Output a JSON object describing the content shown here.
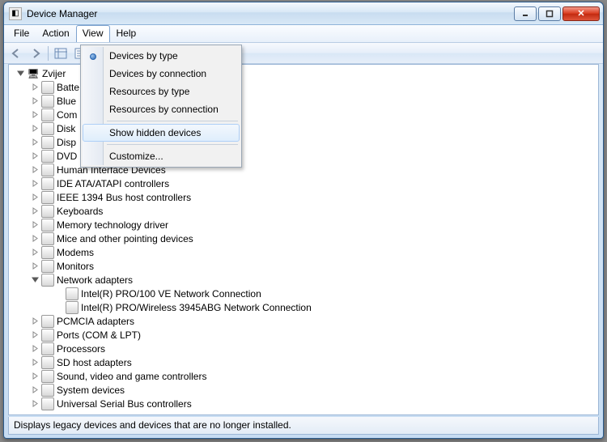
{
  "window": {
    "title": "Device Manager"
  },
  "menu": {
    "file": "File",
    "action": "Action",
    "view": "View",
    "help": "Help"
  },
  "dropdown": {
    "devices_by_type": "Devices by type",
    "devices_by_connection": "Devices by connection",
    "resources_by_type": "Resources by type",
    "resources_by_connection": "Resources by connection",
    "show_hidden": "Show hidden devices",
    "customize": "Customize...",
    "selected": "devices_by_type"
  },
  "tree": {
    "root": "Zvijer",
    "categories": [
      {
        "label": "Batteries",
        "truncated": "Batte"
      },
      {
        "label": "Bluetooth Radios",
        "truncated": "Blue"
      },
      {
        "label": "Computer",
        "truncated": "Com"
      },
      {
        "label": "Disk drives",
        "truncated": "Disk"
      },
      {
        "label": "Display adapters",
        "truncated": "Disp"
      },
      {
        "label": "DVD/CD-ROM drives",
        "truncated": "DVD"
      },
      {
        "label": "Human Interface Devices"
      },
      {
        "label": "IDE ATA/ATAPI controllers"
      },
      {
        "label": "IEEE 1394 Bus host controllers"
      },
      {
        "label": "Keyboards"
      },
      {
        "label": "Memory technology driver"
      },
      {
        "label": "Mice and other pointing devices"
      },
      {
        "label": "Modems"
      },
      {
        "label": "Monitors"
      },
      {
        "label": "Network adapters",
        "expanded": true,
        "children": [
          "Intel(R) PRO/100 VE Network Connection",
          "Intel(R) PRO/Wireless 3945ABG Network Connection"
        ]
      },
      {
        "label": "PCMCIA adapters"
      },
      {
        "label": "Ports (COM & LPT)"
      },
      {
        "label": "Processors"
      },
      {
        "label": "SD host adapters"
      },
      {
        "label": "Sound, video and game controllers"
      },
      {
        "label": "System devices"
      },
      {
        "label": "Universal Serial Bus controllers"
      }
    ]
  },
  "statusbar": {
    "text": "Displays legacy devices and devices that are no longer installed."
  }
}
